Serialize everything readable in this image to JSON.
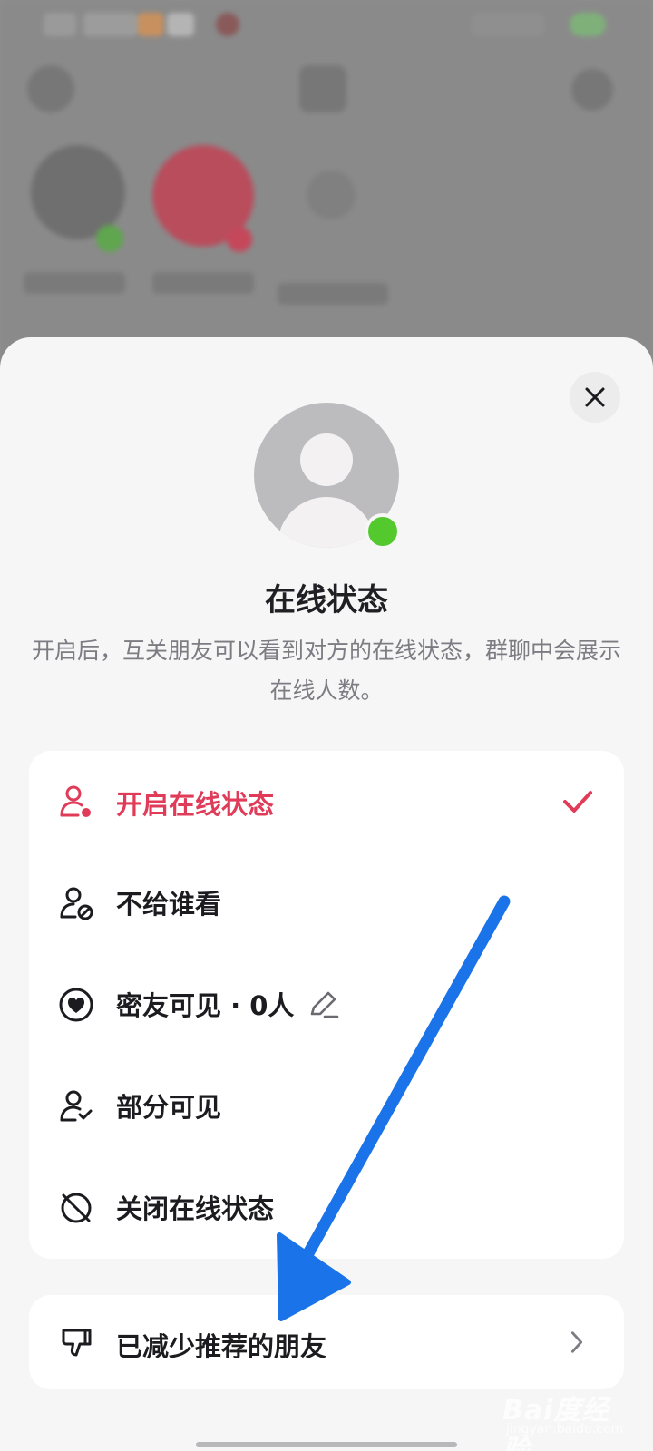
{
  "sheet": {
    "title": "在线状态",
    "description": "开启后，互关朋友可以看到对方的在线状态，群聊中会展示在线人数。"
  },
  "options": [
    {
      "label": "开启在线状态",
      "icon": "person-online-icon",
      "selected": true
    },
    {
      "label": "不给谁看",
      "icon": "person-blocked-icon",
      "selected": false
    },
    {
      "label": "密友可见 · 0人",
      "icon": "heart-circle-icon",
      "selected": false
    },
    {
      "label": "部分可见",
      "icon": "person-check-icon",
      "selected": false
    },
    {
      "label": "关闭在线状态",
      "icon": "circle-slash-icon",
      "selected": false
    }
  ],
  "reduced_recommend": {
    "label": "已减少推荐的朋友",
    "icon": "thumb-down-icon"
  },
  "watermark": {
    "text": "Bai度经验",
    "sub": "jingyan.baidu.com"
  },
  "colors": {
    "accent": "#e03c5a",
    "online_dot": "#53c92e",
    "annotation_arrow": "#1a73e8"
  }
}
